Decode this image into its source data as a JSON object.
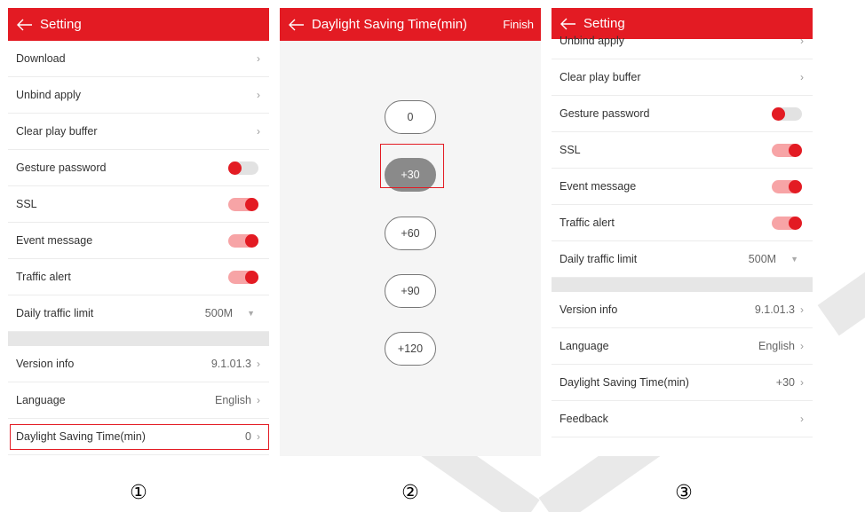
{
  "colors": {
    "accent": "#e31b23",
    "toggle_track_on": "#f7a4a6",
    "selected_option": "#8a8a8a"
  },
  "panel1": {
    "title": "Setting",
    "rows": [
      {
        "label": "Download",
        "type": "arrow"
      },
      {
        "label": "Unbind apply",
        "type": "arrow"
      },
      {
        "label": "Clear play buffer",
        "type": "arrow"
      },
      {
        "label": "Gesture password",
        "type": "toggle",
        "on": false
      },
      {
        "label": "SSL",
        "type": "toggle",
        "on": true
      },
      {
        "label": "Event message",
        "type": "toggle",
        "on": true
      },
      {
        "label": "Traffic alert",
        "type": "toggle",
        "on": true
      },
      {
        "label": "Daily traffic limit",
        "type": "select",
        "value": "500M"
      }
    ],
    "rows2": [
      {
        "label": "Version info",
        "value": "9.1.01.3"
      },
      {
        "label": "Language",
        "value": "English"
      },
      {
        "label": "Daylight Saving Time(min)",
        "value": "0"
      }
    ]
  },
  "panel2": {
    "title": "Daylight Saving Time(min)",
    "finish": "Finish",
    "options": [
      "0",
      "+30",
      "+60",
      "+90",
      "+120"
    ],
    "selected": "+30"
  },
  "panel3": {
    "title": "Setting",
    "rows": [
      {
        "label": "Unbind apply",
        "type": "arrow"
      },
      {
        "label": "Clear play buffer",
        "type": "arrow"
      },
      {
        "label": "Gesture password",
        "type": "toggle",
        "on": false
      },
      {
        "label": "SSL",
        "type": "toggle",
        "on": true
      },
      {
        "label": "Event message",
        "type": "toggle",
        "on": true
      },
      {
        "label": "Traffic alert",
        "type": "toggle",
        "on": true
      },
      {
        "label": "Daily traffic limit",
        "type": "select",
        "value": "500M"
      }
    ],
    "rows2": [
      {
        "label": "Version info",
        "value": "9.1.01.3"
      },
      {
        "label": "Language",
        "value": "English"
      },
      {
        "label": "Daylight Saving Time(min)",
        "value": "+30"
      },
      {
        "label": "Feedback",
        "value": ""
      }
    ]
  },
  "icons": {
    "back": "arrow-left-icon",
    "chevron": "chevron-right-icon",
    "dropdown": "caret-down-icon"
  },
  "glyphs": {
    "chevron": "›",
    "dropdown": "▼"
  },
  "steps": [
    "①",
    "②",
    "③"
  ]
}
